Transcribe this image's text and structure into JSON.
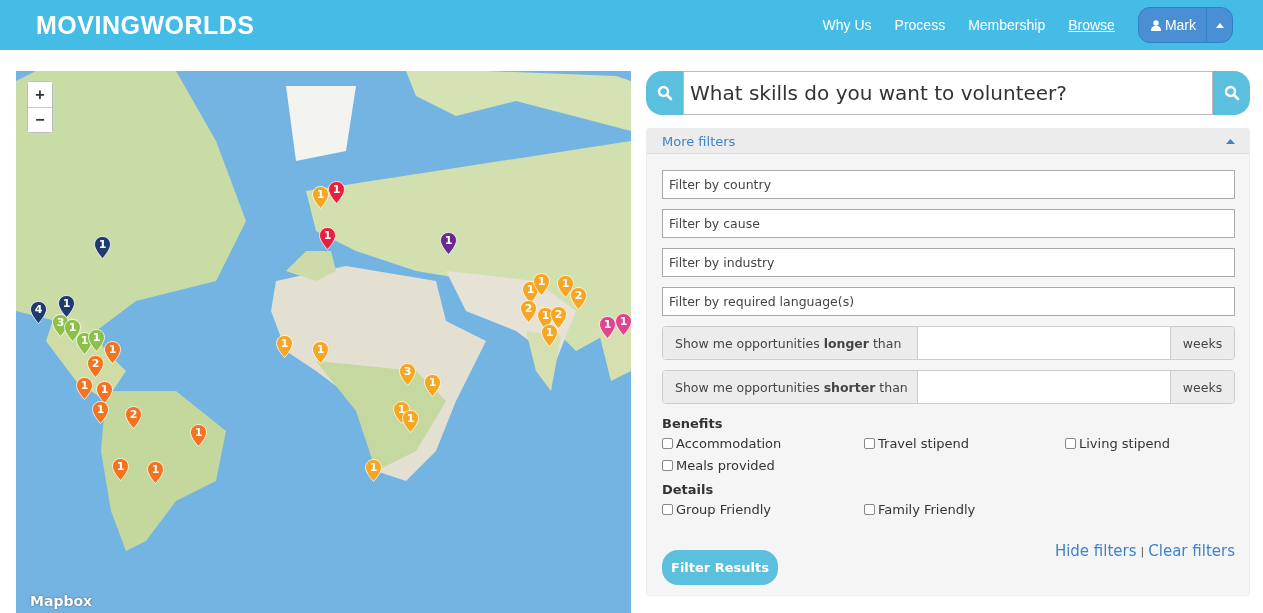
{
  "header": {
    "logo": "MOVINGWORLDS",
    "nav": [
      {
        "label": "Why Us",
        "selected": false
      },
      {
        "label": "Process",
        "selected": false
      },
      {
        "label": "Membership",
        "selected": false
      },
      {
        "label": "Browse",
        "selected": true
      }
    ],
    "user": {
      "name": "Mark"
    }
  },
  "map": {
    "zoom_in": "+",
    "zoom_out": "−",
    "attribution": "Mapbox",
    "pins": [
      {
        "count": "1",
        "color": "#1f3a6e"
      },
      {
        "count": "4",
        "color": "#1f3a6e"
      },
      {
        "count": "1",
        "color": "#1f3a6e"
      },
      {
        "count": "3",
        "color": "#8cc04a"
      },
      {
        "count": "1",
        "color": "#8cc04a"
      },
      {
        "count": "1",
        "color": "#8cc04a"
      },
      {
        "count": "1",
        "color": "#8cc04a"
      },
      {
        "count": "1",
        "color": "#f4731f"
      },
      {
        "count": "2",
        "color": "#f4731f"
      },
      {
        "count": "1",
        "color": "#f4731f"
      },
      {
        "count": "1",
        "color": "#f4731f"
      },
      {
        "count": "1",
        "color": "#f4731f"
      },
      {
        "count": "2",
        "color": "#f4731f"
      },
      {
        "count": "1",
        "color": "#f4731f"
      },
      {
        "count": "1",
        "color": "#f4731f"
      },
      {
        "count": "1",
        "color": "#f4731f"
      },
      {
        "count": "1",
        "color": "#f5a623"
      },
      {
        "count": "1",
        "color": "#e8203e"
      },
      {
        "count": "1",
        "color": "#e8203e"
      },
      {
        "count": "1",
        "color": "#6a2a8f"
      },
      {
        "count": "1",
        "color": "#f5a623"
      },
      {
        "count": "1",
        "color": "#f5a623"
      },
      {
        "count": "3",
        "color": "#f5a623"
      },
      {
        "count": "1",
        "color": "#f5a623"
      },
      {
        "count": "1",
        "color": "#f5a623"
      },
      {
        "count": "1",
        "color": "#f5a623"
      },
      {
        "count": "1",
        "color": "#f5a623"
      },
      {
        "count": "1",
        "color": "#f5a623"
      },
      {
        "count": "1",
        "color": "#f5a623"
      },
      {
        "count": "1",
        "color": "#f5a623"
      },
      {
        "count": "2",
        "color": "#f5a623"
      },
      {
        "count": "2",
        "color": "#f5a623"
      },
      {
        "count": "1",
        "color": "#f5a623"
      },
      {
        "count": "2",
        "color": "#f5a623"
      },
      {
        "count": "1",
        "color": "#f5a623"
      },
      {
        "count": "1",
        "color": "#e0468f"
      },
      {
        "count": "1",
        "color": "#e0468f"
      }
    ]
  },
  "search": {
    "placeholder": "What skills do you want to volunteer?"
  },
  "filters": {
    "title": "More filters",
    "expanded": true,
    "fields": [
      {
        "placeholder": "Filter by country"
      },
      {
        "placeholder": "Filter by cause"
      },
      {
        "placeholder": "Filter by industry"
      },
      {
        "placeholder": "Filter by required language(s)"
      }
    ],
    "durations": [
      {
        "label": "Show me opportunities **longer** than",
        "unit": "weeks"
      },
      {
        "label": "Show me opportunities **shorter** than",
        "unit": "weeks"
      }
    ],
    "groups": [
      {
        "title": "Benefits",
        "options": [
          {
            "label": "Accommodation",
            "checked": false
          },
          {
            "label": "Travel stipend",
            "checked": false
          },
          {
            "label": "Living stipend",
            "checked": false
          },
          {
            "label": "Meals provided",
            "checked": false
          }
        ]
      },
      {
        "title": "Details",
        "options": [
          {
            "label": "Group Friendly",
            "checked": false
          },
          {
            "label": "Family Friendly",
            "checked": false
          }
        ]
      }
    ],
    "submit": "Filter Results",
    "links": [
      "Hide filters",
      "Clear filters"
    ],
    "separator": "|"
  }
}
